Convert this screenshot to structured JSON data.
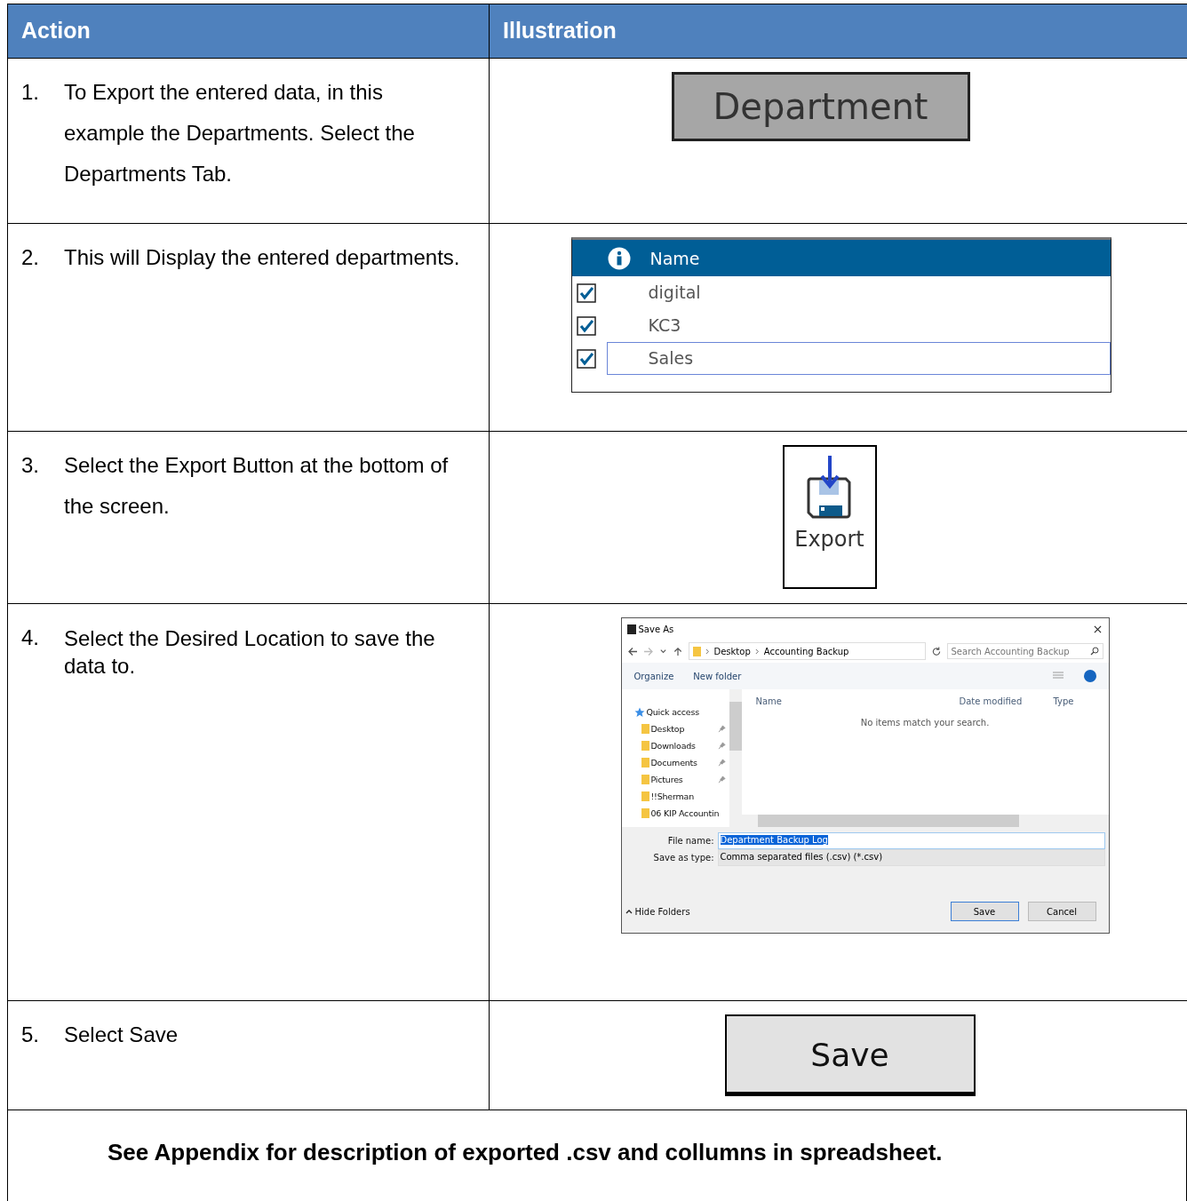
{
  "table": {
    "columns": [
      "Action",
      "Illustration"
    ],
    "rows": [
      {
        "number": "1.",
        "text": "To Export the entered data, in this example the Departments. Select the Departments Tab.",
        "illustration": {
          "kind": "tab",
          "label": "Department"
        }
      },
      {
        "number": "2.",
        "text": "This will Display the entered departments.",
        "illustration": {
          "kind": "list",
          "header": "Name",
          "items": [
            {
              "name": "digital",
              "checked": true,
              "selected": false
            },
            {
              "name": "KC3",
              "checked": true,
              "selected": false
            },
            {
              "name": "Sales",
              "checked": true,
              "selected": true
            }
          ]
        }
      },
      {
        "number": "3.",
        "text": "Select the Export Button at the bottom of the screen.",
        "illustration": {
          "kind": "export",
          "label": "Export"
        }
      },
      {
        "number": "4.",
        "text": "Select the Desired Location to save the data to.",
        "illustration": {
          "kind": "dialog",
          "title": "Save As",
          "breadcrumb": [
            "Desktop",
            "Accounting Backup"
          ],
          "search_placeholder": "Search Accounting Backup",
          "toolbar": [
            "Organize",
            "New folder"
          ],
          "nav": [
            {
              "label": "Quick access",
              "kind": "star",
              "pinned": false
            },
            {
              "label": "Desktop",
              "kind": "folder",
              "pinned": true
            },
            {
              "label": "Downloads",
              "kind": "folder",
              "pinned": true
            },
            {
              "label": "Documents",
              "kind": "folder",
              "pinned": true
            },
            {
              "label": "Pictures",
              "kind": "folder",
              "pinned": true
            },
            {
              "label": "!!Sherman",
              "kind": "folder",
              "pinned": false
            },
            {
              "label": "06 KIP Accountin",
              "kind": "folder",
              "pinned": false
            }
          ],
          "columns": [
            "Name",
            "Date modified",
            "Type"
          ],
          "empty_message": "No items match your search.",
          "file_name_label": "File name:",
          "file_name": "Department Backup Log",
          "type_label": "Save as type:",
          "file_type": "Comma separated files (.csv) (*.csv)",
          "hide_folders": "Hide Folders",
          "buttons": [
            "Save",
            "Cancel"
          ]
        }
      },
      {
        "number": "5.",
        "text": "Select Save",
        "illustration": {
          "kind": "button",
          "label": "Save"
        }
      }
    ]
  },
  "footer": "See Appendix for description of exported .csv and collumns in spreadsheet."
}
